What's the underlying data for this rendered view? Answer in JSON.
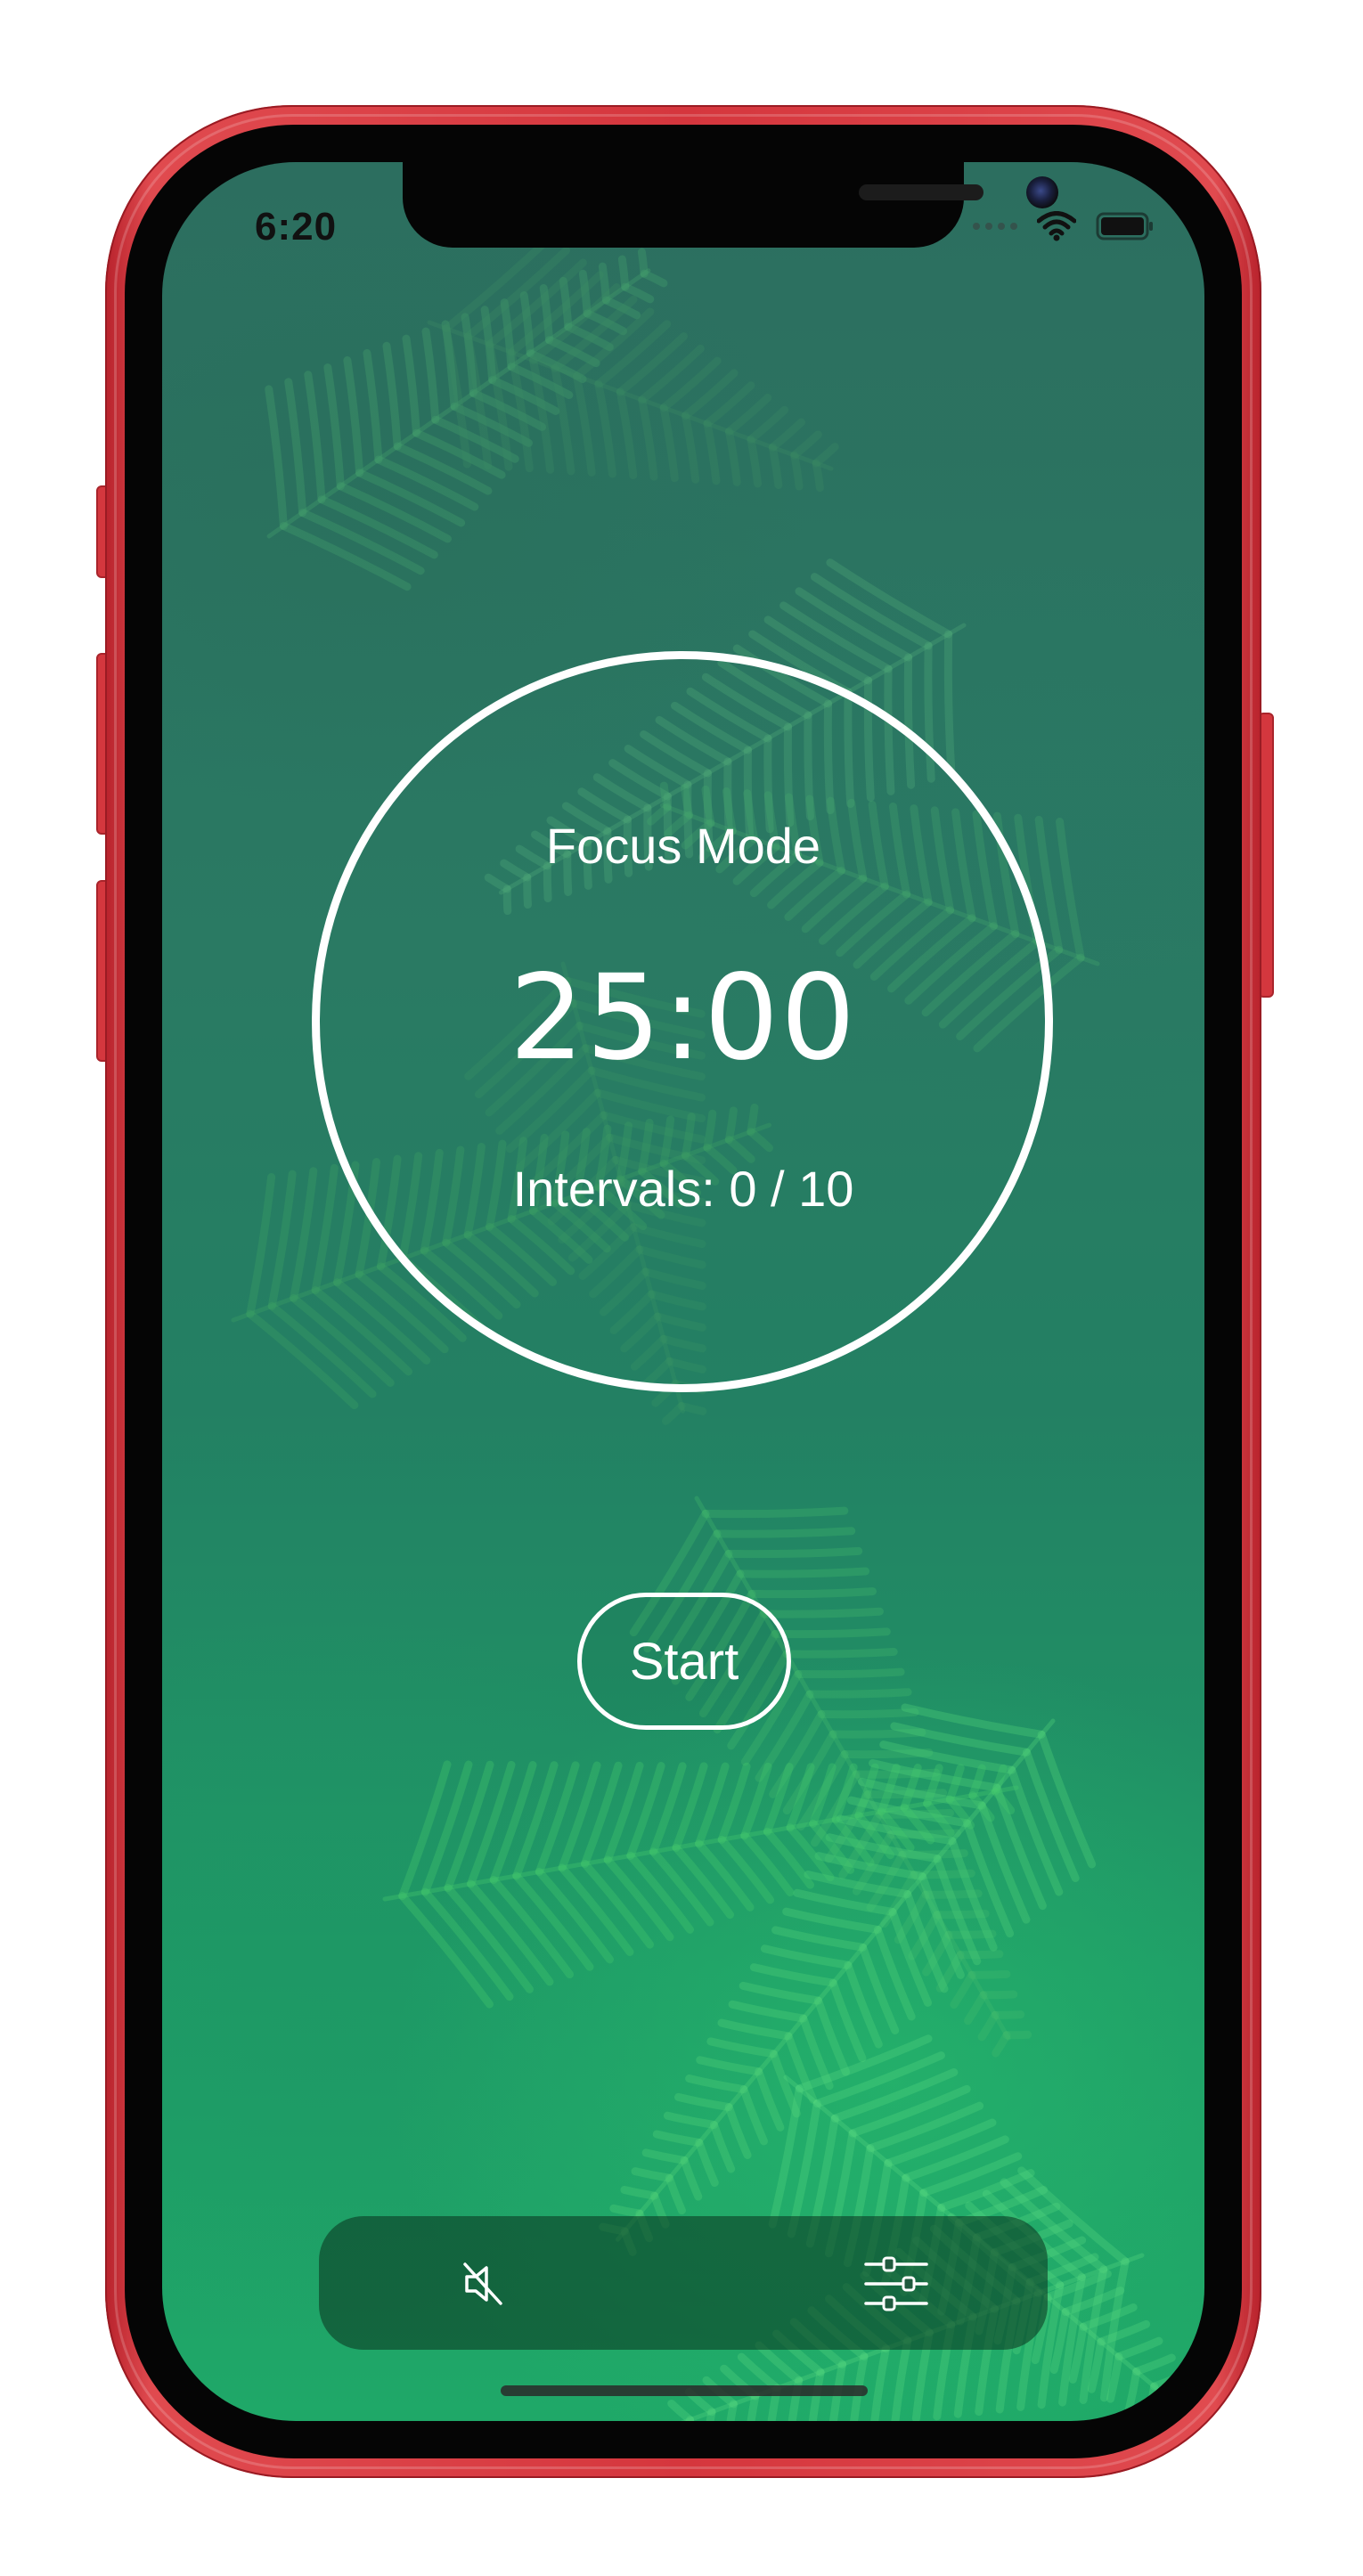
{
  "status_bar": {
    "time": "6:20"
  },
  "timer": {
    "mode_label": "Focus Mode",
    "time_remaining": "25:00",
    "intervals_text": "Intervals: 0 /  10"
  },
  "controls": {
    "start_label": "Start"
  },
  "toolbar": {
    "mute_icon": "speaker-muted-icon",
    "settings_icon": "sliders-icon"
  },
  "colors": {
    "frame": "#d5363d",
    "background": "#238063",
    "foreground": "#ffffff"
  }
}
